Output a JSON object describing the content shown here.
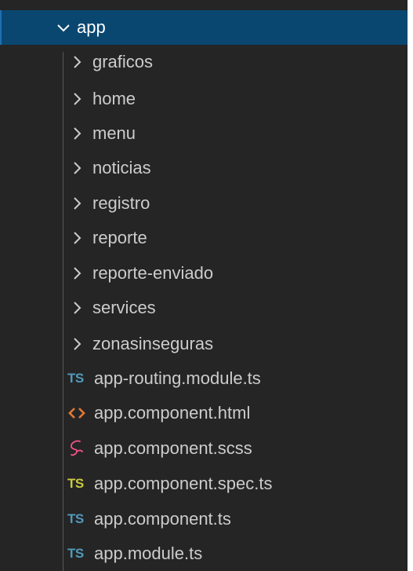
{
  "explorer": {
    "root": {
      "label": "app",
      "icon": "chevron-down-icon",
      "expanded": true
    },
    "folders": [
      {
        "label": "graficos",
        "icon": "chevron-right-icon"
      },
      {
        "label": "home",
        "icon": "chevron-right-icon"
      },
      {
        "label": "menu",
        "icon": "chevron-right-icon"
      },
      {
        "label": "noticias",
        "icon": "chevron-right-icon"
      },
      {
        "label": "registro",
        "icon": "chevron-right-icon"
      },
      {
        "label": "reporte",
        "icon": "chevron-right-icon"
      },
      {
        "label": "reporte-enviado",
        "icon": "chevron-right-icon"
      },
      {
        "label": "services",
        "icon": "chevron-right-icon"
      },
      {
        "label": "zonasinseguras",
        "icon": "chevron-right-icon"
      }
    ],
    "files": [
      {
        "label": "app-routing.module.ts",
        "icon": "typescript-file-icon",
        "badge": "TS",
        "color": "#519aba"
      },
      {
        "label": "app.component.html",
        "icon": "html-file-icon",
        "color": "#e37933"
      },
      {
        "label": "app.component.scss",
        "icon": "sass-file-icon",
        "color": "#f55385"
      },
      {
        "label": "app.component.spec.ts",
        "icon": "typescript-spec-file-icon",
        "badge": "TS",
        "color": "#cbcb41"
      },
      {
        "label": "app.component.ts",
        "icon": "typescript-file-icon",
        "badge": "TS",
        "color": "#519aba"
      },
      {
        "label": "app.module.ts",
        "icon": "typescript-file-icon",
        "badge": "TS",
        "color": "#519aba"
      }
    ]
  },
  "colors": {
    "background": "#252526",
    "selected_background": "#094771",
    "text": "#cccccc",
    "selected_text": "#ffffff"
  }
}
